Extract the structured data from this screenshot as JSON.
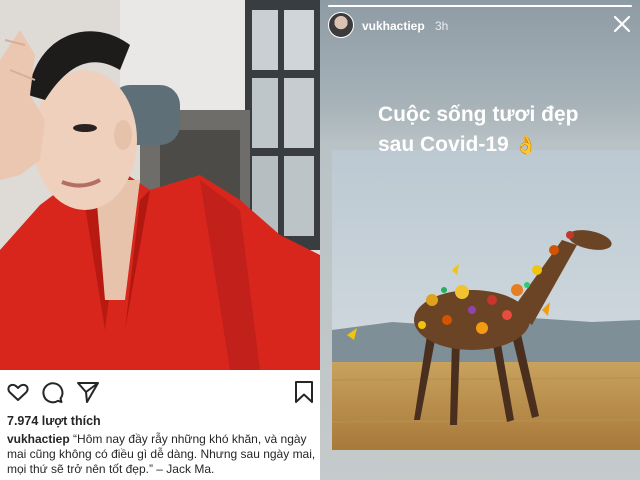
{
  "post": {
    "photo_icon": "selfie-photo",
    "actions": {
      "like_icon": "heart-icon",
      "comment_icon": "comment-icon",
      "share_icon": "send-icon",
      "save_icon": "bookmark-icon"
    },
    "likes": "7.974 lượt thích",
    "caption": {
      "username": "vukhactiep",
      "text": "“Hôm nay đầy rẫy những khó khăn, và ngày mai cũng không có điều gì dễ dàng. Nhưng sau ngày mai, mọi thứ sẽ trở nên tốt đẹp.” – Jack Ma."
    }
  },
  "story": {
    "username": "vukhactiep",
    "time": "3h",
    "close_icon": "close-icon",
    "text": "Cuộc sống tươi đẹp sau Covid-19",
    "emoji": "👌",
    "image_icon": "flower-giraffe-image",
    "progress": 1.0
  },
  "colors": {
    "shirt": "#d9261c",
    "story_bg": "#a7b3b9",
    "text": "#262626"
  }
}
